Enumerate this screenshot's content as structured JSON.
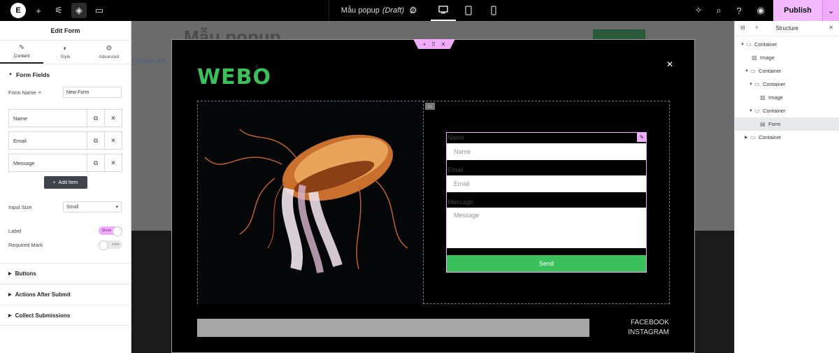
{
  "topbar": {
    "doc_title": "Mẫu popup",
    "doc_status": "(Draft)",
    "publish_label": "Publish"
  },
  "panel": {
    "title": "Edit Form",
    "tabs": [
      "Content",
      "Style",
      "Advanced"
    ],
    "form_fields_heading": "Form Fields",
    "form_name_label": "Form Name",
    "form_name_value": "New Form",
    "items": [
      "Name",
      "Email",
      "Message"
    ],
    "add_item_label": "Add Item",
    "input_size_label": "Input Size",
    "input_size_value": "Small",
    "label_label": "Label",
    "label_toggle": "Show",
    "required_label": "Required Mark",
    "required_toggle": "Hide",
    "sections": [
      "Buttons",
      "Actions After Submit",
      "Collect Submissions"
    ]
  },
  "canvas": {
    "bg_title": "Mẫu popup",
    "bg_link": "Content Are",
    "brand": "WEBO",
    "form": {
      "name_label": "Name",
      "name_placeholder": "Name",
      "email_label": "Email",
      "email_placeholder": "Email",
      "message_label": "Message",
      "message_placeholder": "Message",
      "send_label": "Send"
    },
    "social": [
      "FACEBOOK",
      "INSTAGRAM"
    ]
  },
  "structure": {
    "title": "Structure",
    "nodes": [
      "Container",
      "Image",
      "Container",
      "Container",
      "Image",
      "Container",
      "Form",
      "Container"
    ]
  },
  "colors": {
    "accent": "#f0abfc",
    "brand_green": "#3bc15c"
  }
}
